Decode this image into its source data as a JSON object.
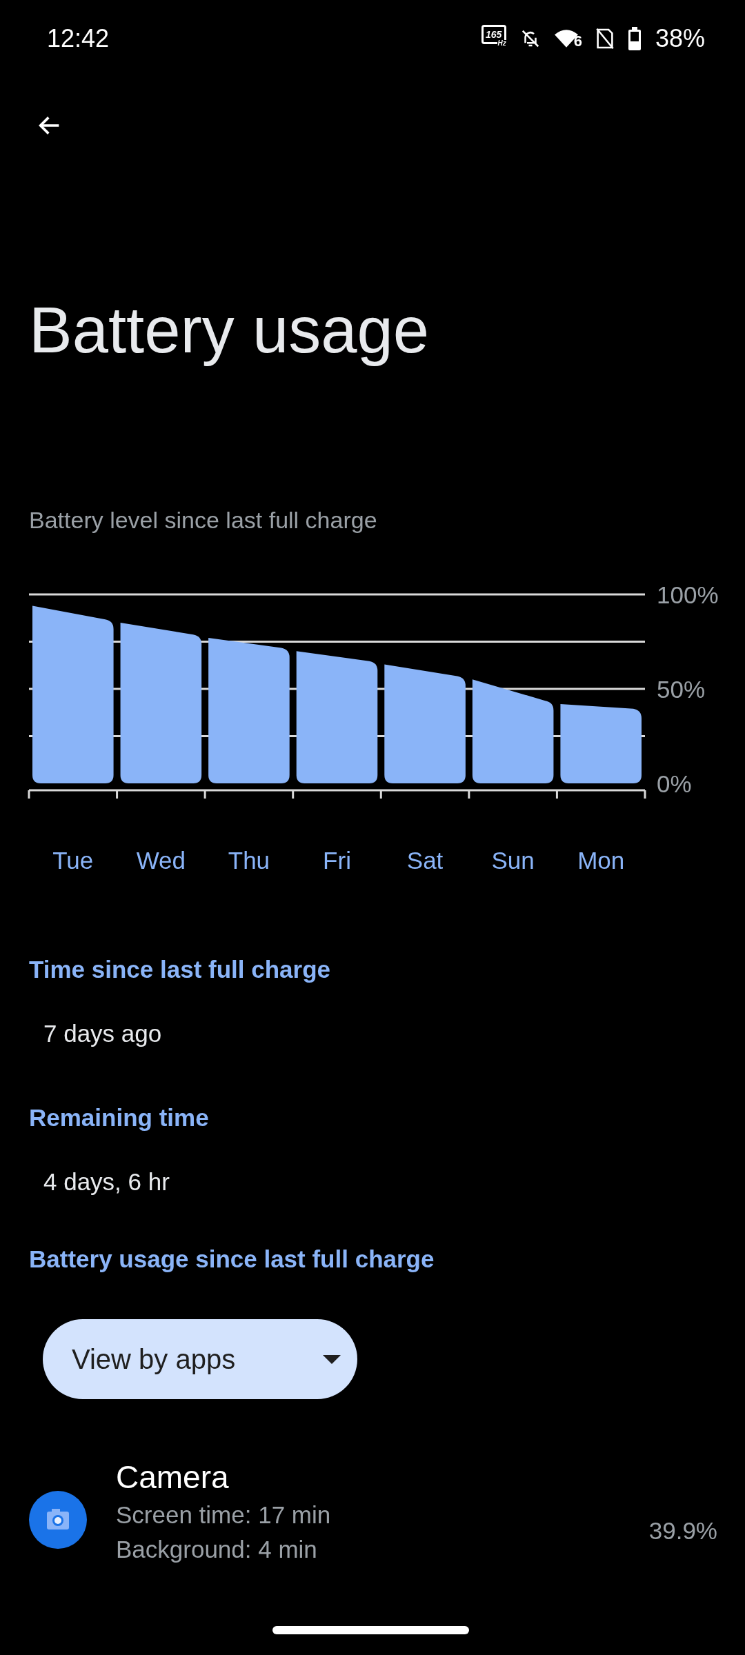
{
  "status_bar": {
    "time": "12:42",
    "refresh_rate": "165",
    "refresh_unit": "Hz",
    "wifi_label": "6",
    "battery": "38%"
  },
  "title": "Battery usage",
  "chart_section": {
    "subtitle": "Battery level since last full charge",
    "chart_data": {
      "type": "bar",
      "categories": [
        "Tue",
        "Wed",
        "Thu",
        "Fri",
        "Sat",
        "Sun",
        "Mon"
      ],
      "series": [
        {
          "color": "#8ab4f8",
          "values": [
            94,
            85,
            77,
            70,
            63,
            55,
            42
          ]
        }
      ],
      "ylim": [
        0,
        100
      ],
      "yticks": [
        {
          "value": 0,
          "label": "0%"
        },
        {
          "value": 50,
          "label": "50%"
        },
        {
          "value": 100,
          "label": "100%"
        }
      ]
    }
  },
  "info": [
    {
      "heading": "Time since last full charge",
      "value": "7 days ago"
    },
    {
      "heading": "Remaining time",
      "value": "4 days, 6 hr"
    }
  ],
  "usage_heading": "Battery usage since last full charge",
  "dropdown": {
    "label": "View by apps"
  },
  "apps": [
    {
      "name": "Camera",
      "lines": [
        "Screen time: 17 min",
        "Background: 4 min"
      ],
      "percent": "39.9%"
    }
  ]
}
